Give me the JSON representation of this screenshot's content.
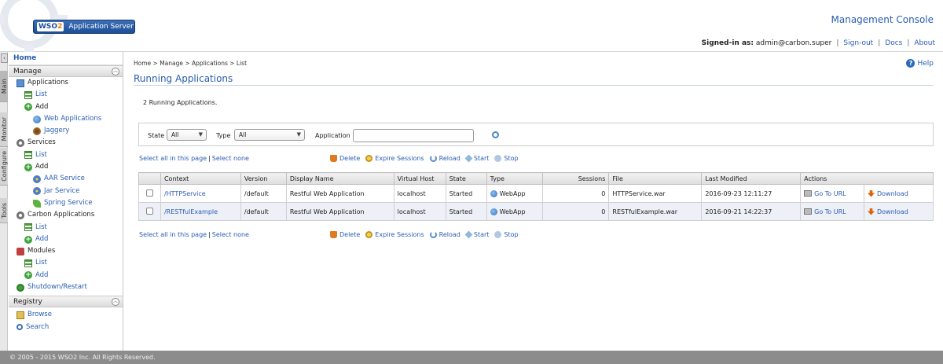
{
  "header": {
    "brand": "WSO",
    "brand_suffix": "2",
    "product": "Application Server",
    "console_title": "Management Console",
    "signed_in_label": "Signed-in as:",
    "user": "admin@carbon.super",
    "sign_out": "Sign-out",
    "docs": "Docs",
    "about": "About"
  },
  "side_tabs": [
    "Main",
    "Monitor",
    "Configure",
    "Tools"
  ],
  "menu": {
    "home": "Home",
    "manage_section": "Manage",
    "applications": "Applications",
    "app_list": "List",
    "app_add": "Add",
    "web_applications": "Web Applications",
    "jaggery": "Jaggery",
    "services": "Services",
    "svc_list": "List",
    "svc_add": "Add",
    "aar_service": "AAR Service",
    "jar_service": "Jar Service",
    "spring_service": "Spring Service",
    "carbon_applications": "Carbon Applications",
    "ca_list": "List",
    "ca_add": "Add",
    "modules": "Modules",
    "mod_list": "List",
    "mod_add": "Add",
    "shutdown": "Shutdown/Restart",
    "registry_section": "Registry",
    "browse": "Browse",
    "search": "Search"
  },
  "content": {
    "breadcrumb": "Home > Manage > Applications > List",
    "help": "Help",
    "title": "Running Applications",
    "count_text": "2 Running Applications.",
    "filter": {
      "state_label": "State",
      "state_value": "All",
      "type_label": "Type",
      "type_value": "All",
      "application_label": "Application"
    },
    "select_all": "Select all in this page",
    "select_none": "Select none",
    "actions": {
      "delete": "Delete",
      "expire": "Expire Sessions",
      "reload": "Reload",
      "start": "Start",
      "stop": "Stop"
    },
    "table": {
      "headers": [
        "Context",
        "Version",
        "Display Name",
        "Virtual Host",
        "State",
        "Type",
        "Sessions",
        "File",
        "Last Modified",
        "Actions"
      ],
      "rows": [
        {
          "context": "/HTTPService",
          "version": "/default",
          "display_name": "Restful Web Application",
          "virtual_host": "localhost",
          "state": "Started",
          "type": "WebApp",
          "sessions": "0",
          "file": "HTTPService.war",
          "last_modified": "2016-09-23 12:11:27",
          "go_to_url": "Go To URL",
          "download": "Download"
        },
        {
          "context": "/RESTfulExample",
          "version": "/default",
          "display_name": "Restful Web Application",
          "virtual_host": "localhost",
          "state": "Started",
          "type": "WebApp",
          "sessions": "0",
          "file": "RESTfulExample.war",
          "last_modified": "2016-09-21 14:22:37",
          "go_to_url": "Go To URL",
          "download": "Download"
        }
      ]
    }
  },
  "footer": "© 2005 - 2015 WSO2 Inc. All Rights Reserved."
}
